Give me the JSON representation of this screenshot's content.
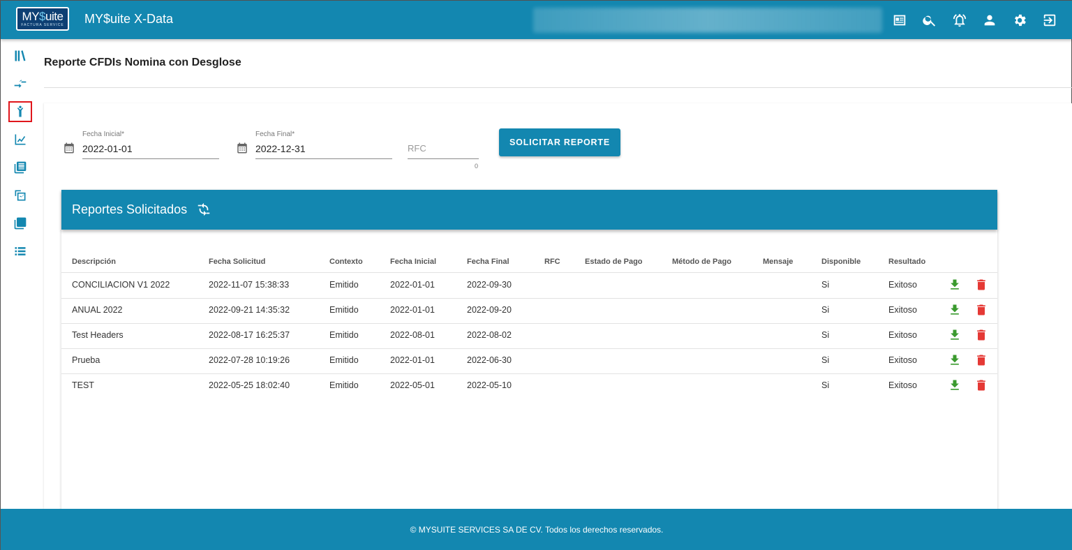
{
  "header": {
    "logo_main_a": "MY",
    "logo_main_s": "$",
    "logo_main_b": "uite",
    "logo_sub": "FACTURA SERVICE",
    "app_title": "MY$uite X-Data"
  },
  "top_icons": [
    "news-icon",
    "search-icon",
    "alarm-icon",
    "user-icon",
    "gear-icon",
    "logout-icon"
  ],
  "sidebar": {
    "items": [
      "library-icon",
      "transfer-icon",
      "person-icon",
      "chart-icon",
      "document-list-icon",
      "compare-icon",
      "copy-icon",
      "list-icon"
    ],
    "active_index": 2
  },
  "page": {
    "title": "Reporte CFDIs Nomina con Desglose"
  },
  "form": {
    "fecha_inicial_label": "Fecha Inicial*",
    "fecha_inicial_value": "2022-01-01",
    "fecha_final_label": "Fecha Final*",
    "fecha_final_value": "2022-12-31",
    "rfc_placeholder": "RFC",
    "rfc_counter": "0",
    "submit_label": "SOLICITAR REPORTE"
  },
  "reports": {
    "title": "Reportes Solicitados",
    "columns": [
      "Descripción",
      "Fecha Solicitud",
      "Contexto",
      "Fecha Inicial",
      "Fecha Final",
      "RFC",
      "Estado de Pago",
      "Método de Pago",
      "Mensaje",
      "Disponible",
      "Resultado"
    ],
    "rows": [
      {
        "descripcion": "CONCILIACION V1 2022",
        "fecha_solicitud": "2022-11-07 15:38:33",
        "contexto": "Emitido",
        "fecha_inicial": "2022-01-01",
        "fecha_final": "2022-09-30",
        "rfc": "",
        "estado_pago": "",
        "metodo_pago": "",
        "mensaje": "",
        "disponible": "Si",
        "resultado": "Exitoso"
      },
      {
        "descripcion": "ANUAL 2022",
        "fecha_solicitud": "2022-09-21 14:35:32",
        "contexto": "Emitido",
        "fecha_inicial": "2022-01-01",
        "fecha_final": "2022-09-20",
        "rfc": "",
        "estado_pago": "",
        "metodo_pago": "",
        "mensaje": "",
        "disponible": "Si",
        "resultado": "Exitoso"
      },
      {
        "descripcion": "Test Headers",
        "fecha_solicitud": "2022-08-17 16:25:37",
        "contexto": "Emitido",
        "fecha_inicial": "2022-08-01",
        "fecha_final": "2022-08-02",
        "rfc": "",
        "estado_pago": "",
        "metodo_pago": "",
        "mensaje": "",
        "disponible": "Si",
        "resultado": "Exitoso"
      },
      {
        "descripcion": "Prueba",
        "fecha_solicitud": "2022-07-28 10:19:26",
        "contexto": "Emitido",
        "fecha_inicial": "2022-01-01",
        "fecha_final": "2022-06-30",
        "rfc": "",
        "estado_pago": "",
        "metodo_pago": "",
        "mensaje": "",
        "disponible": "Si",
        "resultado": "Exitoso"
      },
      {
        "descripcion": "TEST",
        "fecha_solicitud": "2022-05-25 18:02:40",
        "contexto": "Emitido",
        "fecha_inicial": "2022-05-01",
        "fecha_final": "2022-05-10",
        "rfc": "",
        "estado_pago": "",
        "metodo_pago": "",
        "mensaje": "",
        "disponible": "Si",
        "resultado": "Exitoso"
      }
    ],
    "row_actions": [
      "download-icon",
      "delete-icon"
    ]
  },
  "colors": {
    "primary": "#1387b0",
    "download": "#3a9a2e",
    "delete": "#e53935",
    "active_outline": "#e0161c"
  },
  "footer": {
    "text": "© MYSUITE SERVICES SA DE CV. Todos los derechos reservados."
  }
}
